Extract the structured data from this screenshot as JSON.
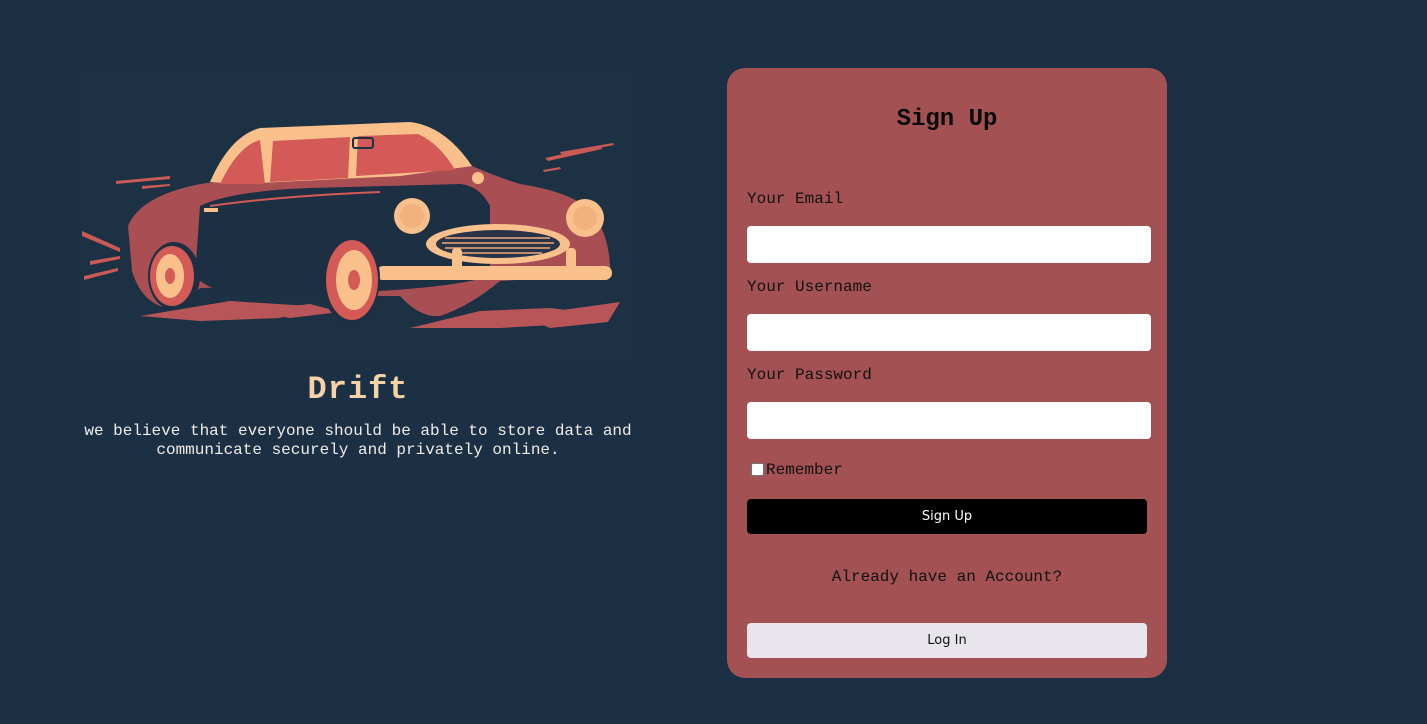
{
  "brand": {
    "name": "Drift",
    "tagline": "we believe that everyone should be able to store data and communicate securely and privately online."
  },
  "hero": {
    "image_icon": "vintage-car-illustration"
  },
  "signup": {
    "title": "Sign Up",
    "fields": [
      {
        "label": "Your Email",
        "value": "",
        "placeholder": ""
      },
      {
        "label": "Your Username",
        "value": "",
        "placeholder": ""
      },
      {
        "label": "Your Password",
        "value": "",
        "placeholder": ""
      }
    ],
    "remember": {
      "label": "Remember",
      "checked": false
    },
    "submit_label": "Sign Up",
    "already_text": "Already have an Account?",
    "login_label": "Log In"
  },
  "colors": {
    "background": "#1b2f45",
    "card": "#a35153",
    "brand_text": "#f6d3a6",
    "car_body": "#a94e52",
    "car_accent": "#f9c08c"
  }
}
